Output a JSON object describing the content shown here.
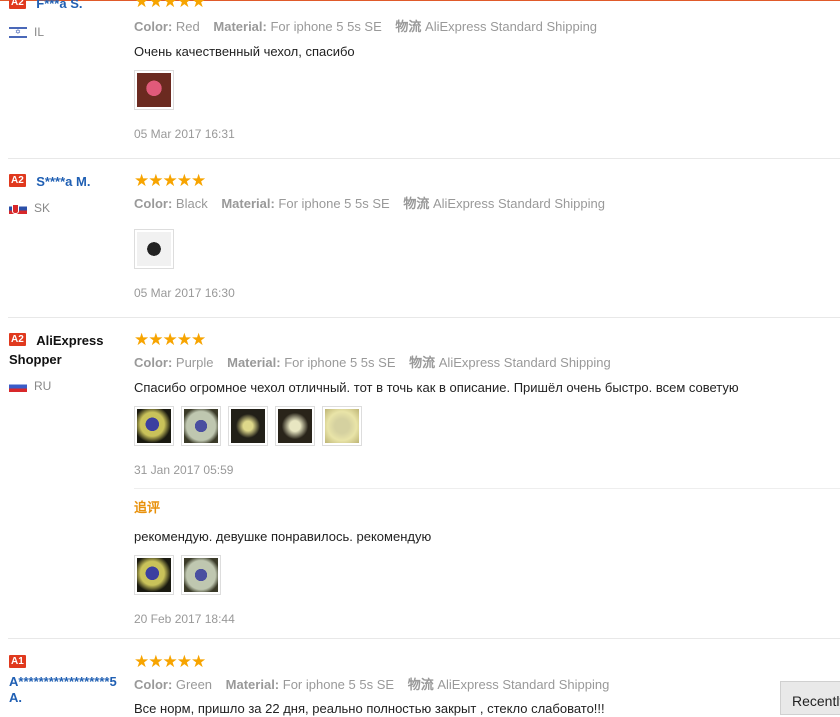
{
  "labels": {
    "color": "Color:",
    "material": "Material:",
    "shipping_label": "物流"
  },
  "reviews": [
    {
      "level": "A2",
      "user": "F***a S.",
      "country": "IL",
      "stars": "★★★★★",
      "color": "Red",
      "material": "For iphone 5 5s SE",
      "shipping": "AliExpress Standard Shipping",
      "text": "Очень качественный чехол, спасибо",
      "date": "05 Mar 2017 16:31"
    },
    {
      "level": "A2",
      "user": "S****a M.",
      "country": "SK",
      "stars": "★★★★★",
      "color": "Black",
      "material": "For iphone 5 5s SE",
      "shipping": "AliExpress Standard Shipping",
      "text": "",
      "date": "05 Mar 2017 16:30"
    },
    {
      "level": "A2",
      "user_line1": "AliExpress",
      "user_line2": "Shopper",
      "country": "RU",
      "stars": "★★★★★",
      "color": "Purple",
      "material": "For iphone 5 5s SE",
      "shipping": "AliExpress Standard Shipping",
      "text": "Спасибо огромное чехол отличный. тот в точь как в описание. Пришёл очень быстро. всем советую",
      "date": "31 Jan 2017 05:59",
      "followup_label": "追评",
      "followup_text": "рекомендую. девушке понравилось. рекомендую",
      "followup_date": "20 Feb 2017 18:44"
    },
    {
      "level": "A1",
      "user_line1": "A******************5",
      "user_line2": "A.",
      "stars": "★★★★★",
      "color": "Green",
      "material": "For iphone 5 5s SE",
      "shipping": "AliExpress Standard Shipping",
      "text": "Все норм, пришло за 22 дня, реально полностью закрыт , стекло слабовато!!!"
    }
  ],
  "recent_button": "Recently"
}
